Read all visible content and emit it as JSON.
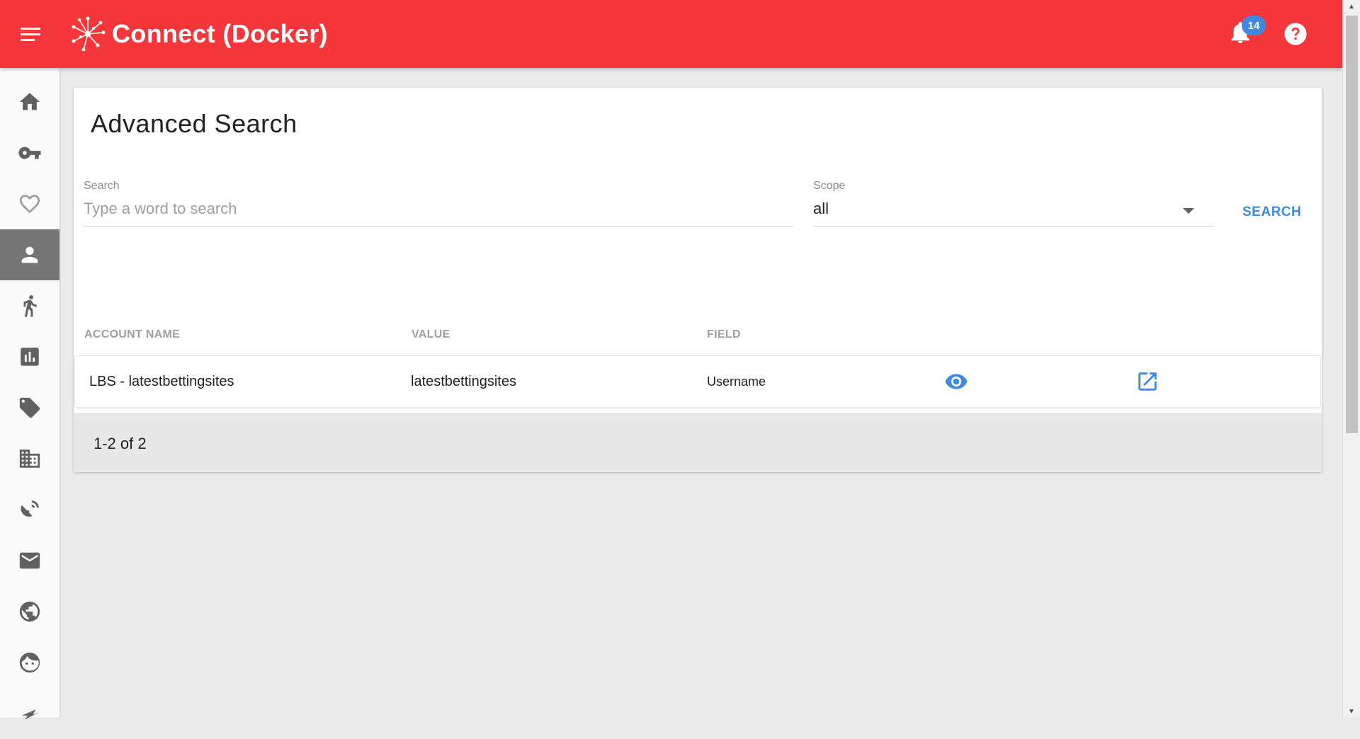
{
  "app": {
    "title": "Connect (Docker)",
    "brand_color": "#f5363b",
    "accent_color": "#3f8ae0"
  },
  "header": {
    "menu_icon": "hamburger-menu-icon",
    "logo_icon": "connect-logo-icon",
    "notifications": {
      "icon": "bell-icon",
      "count": "14"
    },
    "help_icon": "help-circle-icon"
  },
  "sidebar": {
    "items": [
      {
        "icon": "home-icon",
        "active": false
      },
      {
        "icon": "key-icon",
        "active": false
      },
      {
        "icon": "heart-icon",
        "active": false
      },
      {
        "icon": "person-icon",
        "active": true
      },
      {
        "icon": "running-person-icon",
        "active": false
      },
      {
        "icon": "bar-chart-icon",
        "active": false
      },
      {
        "icon": "tag-icon",
        "active": false
      },
      {
        "icon": "building-icon",
        "active": false
      },
      {
        "icon": "satellite-dish-icon",
        "active": false
      },
      {
        "icon": "mail-icon",
        "active": false
      },
      {
        "icon": "globe-icon",
        "active": false
      },
      {
        "icon": "face-icon",
        "active": false
      },
      {
        "icon": "flag-icon",
        "active": false
      }
    ]
  },
  "main": {
    "title": "Advanced Search",
    "search": {
      "label": "Search",
      "placeholder": "Type a word to search",
      "value": ""
    },
    "scope": {
      "label": "Scope",
      "value": "all"
    },
    "search_button": "SEARCH",
    "table": {
      "columns": [
        "ACCOUNT NAME",
        "VALUE",
        "FIELD"
      ],
      "rows": [
        {
          "account_name": "LBS - latestbettingsites",
          "value": "latestbettingsites",
          "field": "Username",
          "view_icon": "eye-icon",
          "open_icon": "open-in-new-icon"
        }
      ]
    },
    "pagination": "1-2 of 2"
  }
}
